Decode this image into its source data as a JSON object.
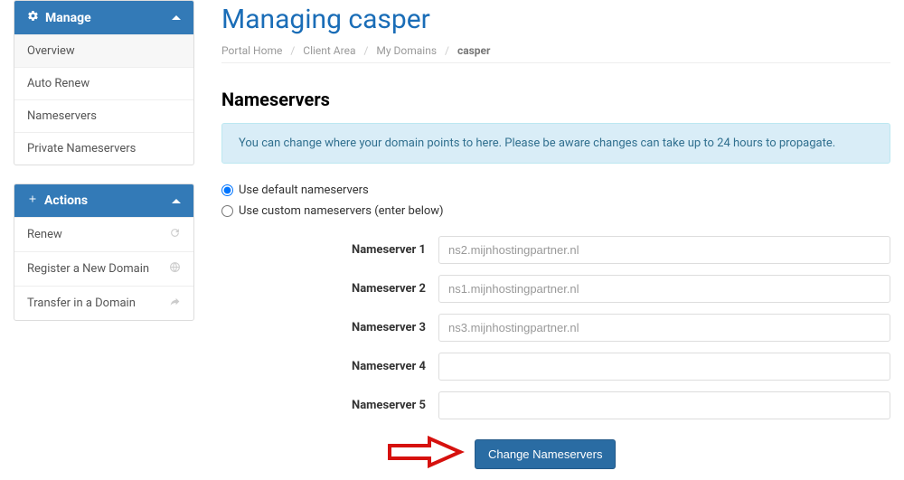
{
  "sidebar": {
    "manage": {
      "title": "Manage",
      "items": [
        {
          "label": "Overview"
        },
        {
          "label": "Auto Renew"
        },
        {
          "label": "Nameservers"
        },
        {
          "label": "Private Nameservers"
        }
      ]
    },
    "actions": {
      "title": "Actions",
      "items": [
        {
          "label": "Renew"
        },
        {
          "label": "Register a New Domain"
        },
        {
          "label": "Transfer in a Domain"
        }
      ]
    }
  },
  "page": {
    "title": "Managing casper",
    "breadcrumbs": {
      "home": "Portal Home",
      "client": "Client Area",
      "domains": "My Domains",
      "current": "casper"
    }
  },
  "section": {
    "title": "Nameservers",
    "info": "You can change where your domain points to here. Please be aware changes can take up to 24 hours to propagate."
  },
  "radios": {
    "default": "Use default nameservers",
    "custom": "Use custom nameservers (enter below)"
  },
  "fields": [
    {
      "label": "Nameserver 1",
      "value": "ns2.mijnhostingpartner.nl"
    },
    {
      "label": "Nameserver 2",
      "value": "ns1.mijnhostingpartner.nl"
    },
    {
      "label": "Nameserver 3",
      "value": "ns3.mijnhostingpartner.nl"
    },
    {
      "label": "Nameserver 4",
      "value": ""
    },
    {
      "label": "Nameserver 5",
      "value": ""
    }
  ],
  "submit_label": "Change Nameservers"
}
